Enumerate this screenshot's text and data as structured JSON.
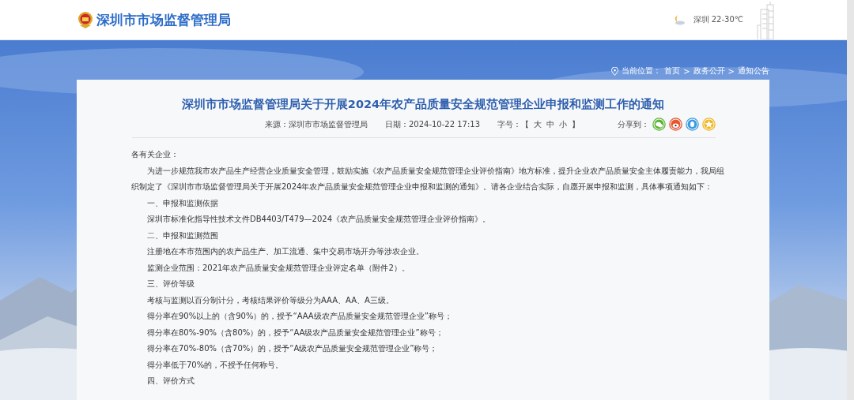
{
  "header": {
    "site_name": "深圳市市场监督管理局",
    "weather": "深圳 22-30℃"
  },
  "breadcrumb": {
    "label": "当前位置：",
    "items": [
      "首页",
      "政务公开",
      "通知公告"
    ],
    "separator": ">"
  },
  "article": {
    "title": "深圳市市场监督管理局关于开展2024年农产品质量安全规范管理企业申报和监测工作的通知",
    "source": "来源：深圳市市场监督管理局",
    "date": "日期：2024-10-22 17:13",
    "font_size": {
      "label": "字号：",
      "open": "【",
      "close": "】",
      "options": [
        "大",
        "中",
        "小"
      ]
    },
    "share_label": "分享到：",
    "share": [
      {
        "kind": "wechat",
        "color": "#5cb531"
      },
      {
        "kind": "weibo",
        "color": "#e8542b"
      },
      {
        "kind": "qq",
        "color": "#3a9be0"
      },
      {
        "kind": "favorite",
        "color": "#f2b51c"
      }
    ],
    "body": [
      {
        "kind": "greeting",
        "text": "各有关企业："
      },
      {
        "kind": "paragraph",
        "text": "为进一步规范我市农产品生产经营企业质量安全管理，鼓励实施《农产品质量安全规范管理企业评价指南》地方标准，提升企业农产品质量安全主体履责能力，我局组织制定了《深圳市市场监督管理局关于开展2024年农产品质量安全规范管理企业申报和监测的通知》。请各企业结合实际，自愿开展申报和监测，具体事项通知如下："
      },
      {
        "kind": "paragraph",
        "text": "一、申报和监测依据"
      },
      {
        "kind": "paragraph",
        "text": "深圳市标准化指导性技术文件DB4403/T479—2024《农产品质量安全规范管理企业评价指南》。"
      },
      {
        "kind": "paragraph",
        "text": "二、申报和监测范围"
      },
      {
        "kind": "paragraph",
        "text": "注册地在本市范围内的农产品生产、加工流通、集中交易市场开办等涉农企业。"
      },
      {
        "kind": "paragraph",
        "text": "监测企业范围：2021年农产品质量安全规范管理企业评定名单（附件2）。"
      },
      {
        "kind": "paragraph",
        "text": "三、评价等级"
      },
      {
        "kind": "paragraph",
        "text": "考核与监测以百分制计分，考核结果评价等级分为AAA、AA、A三级。"
      },
      {
        "kind": "paragraph",
        "text": "得分率在90%以上的（含90%）的，授予“AAA级农产品质量安全规范管理企业”称号；"
      },
      {
        "kind": "paragraph",
        "text": "得分率在80%-90%（含80%）的，授予“AA级农产品质量安全规范管理企业”称号；"
      },
      {
        "kind": "paragraph",
        "text": "得分率在70%-80%（含70%）的，授予“A级农产品质量安全规范管理企业”称号；"
      },
      {
        "kind": "paragraph",
        "text": "得分率低于70%的，不授予任何称号。"
      },
      {
        "kind": "paragraph",
        "text": "四、评价方式"
      }
    ]
  }
}
